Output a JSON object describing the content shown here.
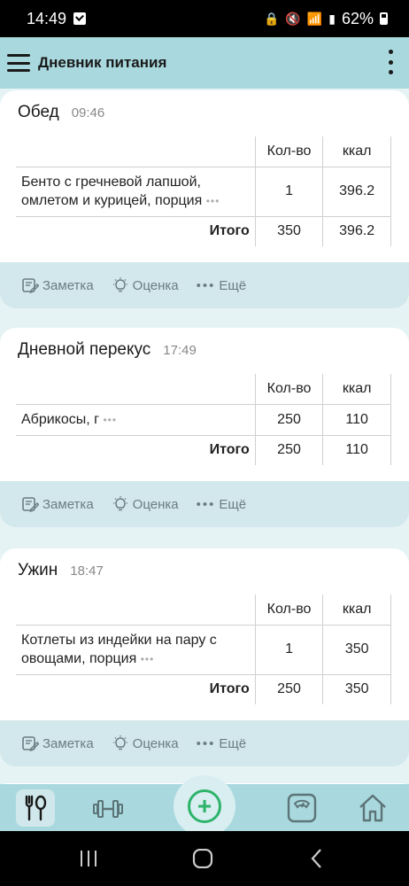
{
  "status": {
    "time": "14:49",
    "battery": "62%"
  },
  "appbar": {
    "title": "Дневник питания"
  },
  "table_headers": {
    "qty": "Кол-во",
    "kcal": "ккал",
    "total": "Итого"
  },
  "actions": {
    "note": "Заметка",
    "rate": "Оценка",
    "more": "Ещё"
  },
  "meals": [
    {
      "name": "Обед",
      "time": "09:46",
      "items": [
        {
          "name_line1": "Бенто с гречневой лапшой,",
          "name_line2": "омлетом и курицей, порция",
          "qty": "1",
          "kcal": "396.2"
        }
      ],
      "total_qty": "350",
      "total_kcal": "396.2"
    },
    {
      "name": "Дневной перекус",
      "time": "17:49",
      "items": [
        {
          "name_line1": "Абрикосы, г",
          "name_line2": "",
          "qty": "250",
          "kcal": "110"
        }
      ],
      "total_qty": "250",
      "total_kcal": "110"
    },
    {
      "name": "Ужин",
      "time": "18:47",
      "items": [
        {
          "name_line1": "Котлеты из индейки на пару с",
          "name_line2": "овощами, порция",
          "qty": "1",
          "kcal": "350"
        }
      ],
      "total_qty": "250",
      "total_kcal": "350"
    }
  ],
  "colors": {
    "accent": "#a9d9de",
    "action_bar": "#d3e8ec",
    "add_button": "#2db36a"
  },
  "icons": {
    "nav": [
      "fork-spoon-icon",
      "dumbbell-icon",
      "add-circle-icon",
      "scale-icon",
      "home-icon"
    ],
    "actions": [
      "note-edit-icon",
      "lightbulb-icon",
      "more-dots-icon"
    ]
  }
}
